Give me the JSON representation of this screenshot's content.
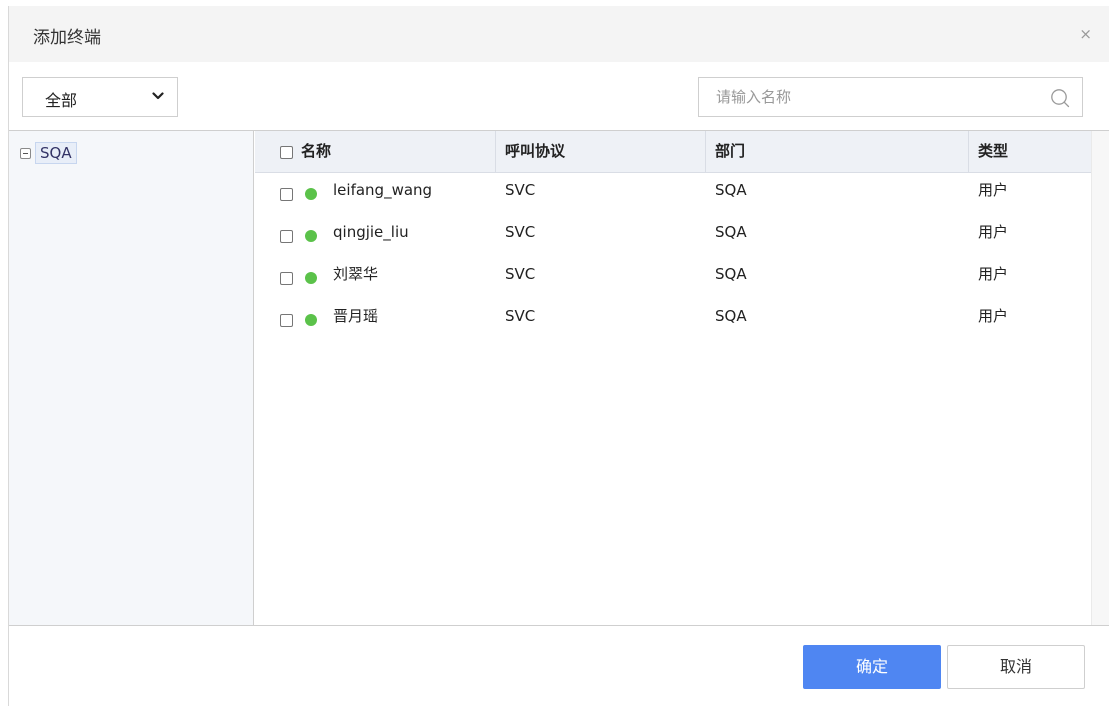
{
  "dialog": {
    "title": "添加终端",
    "close_glyph": "×"
  },
  "filter": {
    "scope_value": "全部",
    "search_placeholder": "请输入名称"
  },
  "tree": {
    "root_label": "SQA"
  },
  "table": {
    "headers": {
      "name": "名称",
      "protocol": "呼叫协议",
      "department": "部门",
      "type": "类型"
    },
    "rows": [
      {
        "name": "leifang_wang",
        "protocol": "SVC",
        "department": "SQA",
        "type": "用户",
        "status_color": "#5bc24a"
      },
      {
        "name": "qingjie_liu",
        "protocol": "SVC",
        "department": "SQA",
        "type": "用户",
        "status_color": "#5bc24a"
      },
      {
        "name": "刘翠华",
        "protocol": "SVC",
        "department": "SQA",
        "type": "用户",
        "status_color": "#5bc24a"
      },
      {
        "name": "晋月瑶",
        "protocol": "SVC",
        "department": "SQA",
        "type": "用户",
        "status_color": "#5bc24a"
      }
    ]
  },
  "footer": {
    "confirm_label": "确定",
    "cancel_label": "取消"
  },
  "colors": {
    "primary": "#4f86f2",
    "status_online": "#5bc24a"
  }
}
